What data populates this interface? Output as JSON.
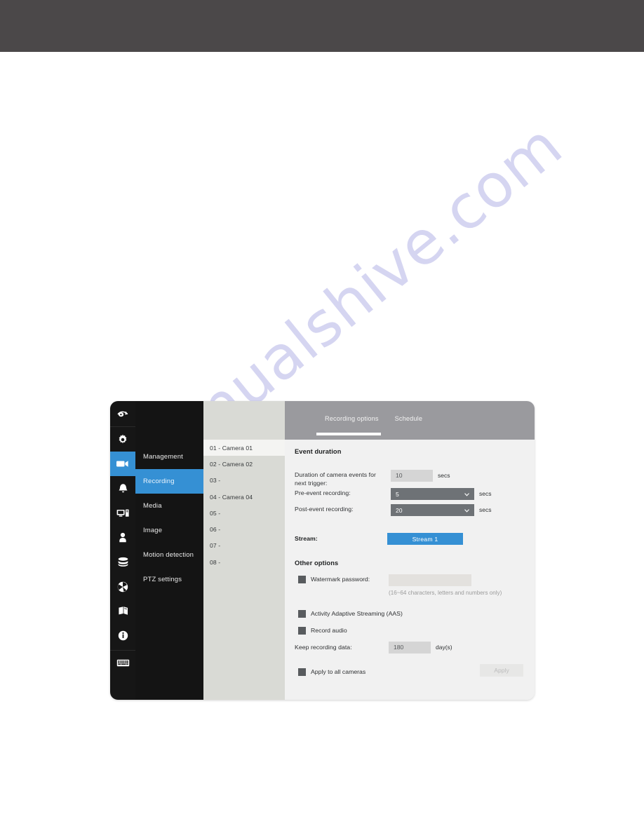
{
  "watermark": {
    "text": "manualshive.com"
  },
  "icon_rail": [
    {
      "name": "logo-eye-icon",
      "label": ""
    },
    {
      "name": "gear-icon",
      "label": ""
    },
    {
      "name": "camera-icon",
      "label": "",
      "active": true
    },
    {
      "name": "bell-icon",
      "label": ""
    },
    {
      "name": "monitor-tower-icon",
      "label": ""
    },
    {
      "name": "person-icon",
      "label": ""
    },
    {
      "name": "database-icon",
      "label": ""
    },
    {
      "name": "pie-chart-icon",
      "label": ""
    },
    {
      "name": "books-icon",
      "label": ""
    },
    {
      "name": "info-icon",
      "label": ""
    },
    {
      "name": "keyboard-icon",
      "label": ""
    }
  ],
  "sidebar": {
    "items": [
      {
        "label": "Management",
        "active": false
      },
      {
        "label": "Recording",
        "active": true
      },
      {
        "label": "Media",
        "active": false
      },
      {
        "label": "Image",
        "active": false
      },
      {
        "label": "Motion detection",
        "active": false
      },
      {
        "label": "PTZ settings",
        "active": false
      }
    ]
  },
  "camera_list": {
    "items": [
      {
        "label": "01 - Camera 01",
        "selected": true
      },
      {
        "label": "02 - Camera 02",
        "selected": false
      },
      {
        "label": "03 -",
        "selected": false
      },
      {
        "label": "04 - Camera 04",
        "selected": false
      },
      {
        "label": "05 -",
        "selected": false
      },
      {
        "label": "06 -",
        "selected": false
      },
      {
        "label": "07 -",
        "selected": false
      },
      {
        "label": "08 -",
        "selected": false
      }
    ]
  },
  "tabs": [
    {
      "label": "Recording options",
      "active": true
    },
    {
      "label": "Schedule",
      "active": false
    }
  ],
  "form": {
    "event_duration_title": "Event duration",
    "duration_label_line1": "Duration of camera events for",
    "duration_label_line2": "next trigger:",
    "duration_value": "10",
    "duration_unit": "secs",
    "pre_event_label": "Pre-event recording:",
    "pre_event_value": "5",
    "pre_event_unit": "secs",
    "post_event_label": "Post-event recording:",
    "post_event_value": "20",
    "post_event_unit": "secs",
    "stream_label": "Stream:",
    "stream_button": "Stream 1",
    "other_options_title": "Other options",
    "watermark_password_label": "Watermark password:",
    "watermark_password_value": "",
    "watermark_password_hint": "(16~64 characters, letters and numbers only)",
    "aas_label": "Activity Adaptive Streaming (AAS)",
    "record_audio_label": "Record audio",
    "keep_data_label": "Keep recording data:",
    "keep_data_value": "180",
    "keep_data_unit": "day(s)",
    "apply_all_label": "Apply to all cameras",
    "apply_button": "Apply"
  },
  "colors": {
    "accent": "#3590d4",
    "rail_bg": "#161616",
    "nav_bg": "#141414",
    "camera_list_bg": "#d9dad5",
    "tab_bar_bg": "#9a9a9e",
    "body_bg": "#f1f1f1",
    "dropdown_bg": "#6e7276",
    "checkbox_fill": "#585b5e",
    "top_band": "#4b4849"
  }
}
